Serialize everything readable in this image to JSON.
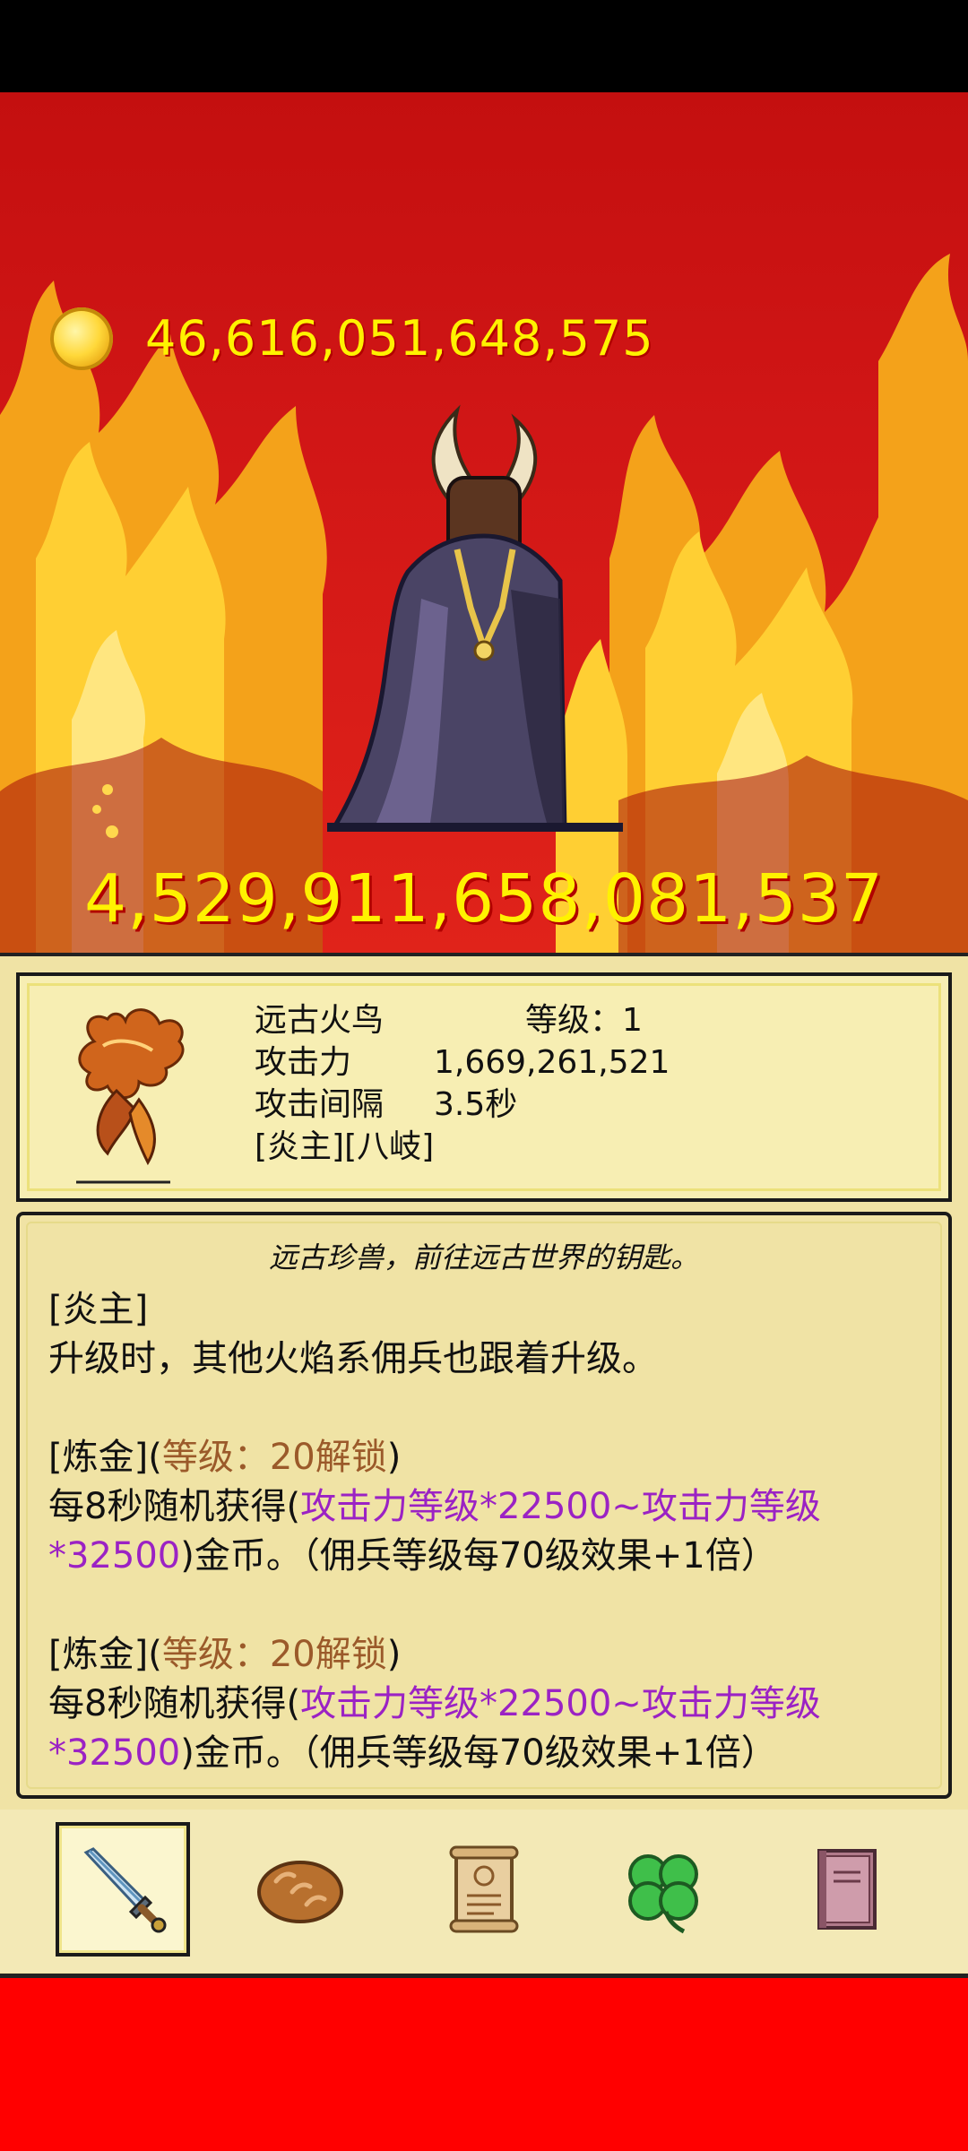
{
  "header": {
    "gold_amount": "46,616,051,648,575"
  },
  "boss": {
    "hp": "4,529,911,658,081,537"
  },
  "hero": {
    "name": "远古火鸟",
    "level_label": "等级：1",
    "attack_label": "攻击力",
    "attack_value": "1,669,261,521",
    "interval_label": "攻击间隔",
    "interval_value": "3.5秒",
    "tags": "[炎主][八岐]"
  },
  "description": {
    "flavor": "远古珍兽，前往远古世界的钥匙。",
    "skill1_title": "[炎主]",
    "skill1_text": "升级时，其他火焰系佣兵也跟着升级。",
    "skill2_title": "[炼金]",
    "skill2_open": "(",
    "skill2_lock": "等级：20解锁",
    "skill2_close": ")",
    "skill2_prefix": "每8秒随机获得(",
    "skill2_formula": "攻击力等级*22500~攻击力等级*32500",
    "skill2_suffix": ")金币。（佣兵等级每70级效果+1倍）",
    "skill3_title": "[炼金]",
    "skill3_open": "(",
    "skill3_lock": "等级：20解锁",
    "skill3_close": ")",
    "skill3_prefix": "每8秒随机获得(",
    "skill3_formula": "攻击力等级*22500~攻击力等级*32500",
    "skill3_suffix": ")金币。（佣兵等级每70级效果+1倍）"
  },
  "tabs": [
    {
      "icon": "sword-icon",
      "active": true
    },
    {
      "icon": "bread-icon",
      "active": false
    },
    {
      "icon": "scroll-icon",
      "active": false
    },
    {
      "icon": "clover-icon",
      "active": false
    },
    {
      "icon": "book-icon",
      "active": false
    }
  ],
  "colors": {
    "gold_text": "#fff200",
    "panel_bg": "#f0e3a5",
    "lock_text": "#9b5a2a",
    "formula_text": "#9b22c4",
    "bottom_bar": "#ff0000"
  }
}
